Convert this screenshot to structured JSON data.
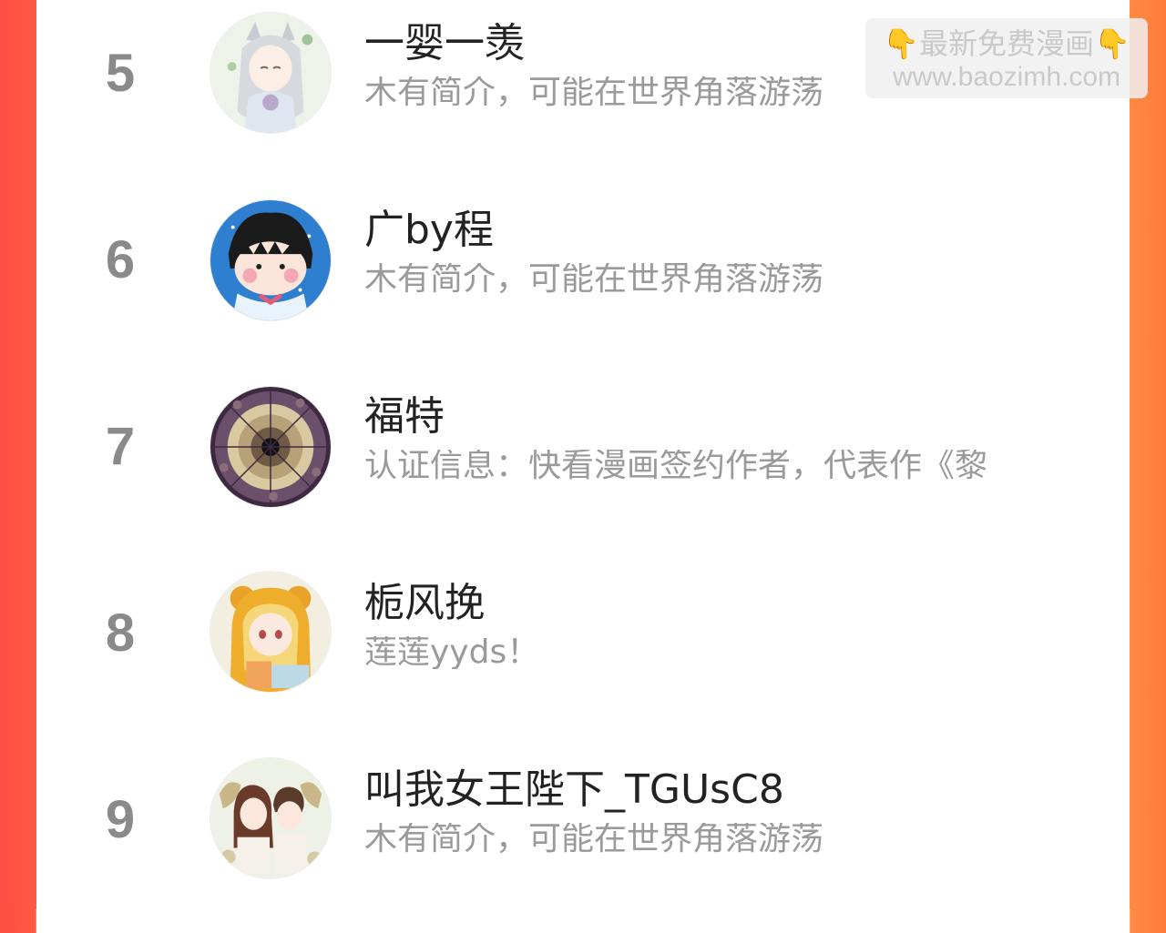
{
  "watermark": {
    "line1": "最新免费漫画",
    "line2": "www.baozimh.com",
    "hand_glyph": "👇"
  },
  "ranking": [
    {
      "rank": "5",
      "name": "一婴一羡",
      "desc": "木有简介，可能在世界角落游荡",
      "avatar": "anime-girl-gray-hair-avatar"
    },
    {
      "rank": "6",
      "name": "广by程",
      "desc": "木有简介，可能在世界角落游荡",
      "avatar": "cartoon-boy-blue-avatar"
    },
    {
      "rank": "7",
      "name": "福特",
      "desc": "认证信息：快看漫画签约作者，代表作《黎",
      "avatar": "vortex-mosaic-avatar"
    },
    {
      "rank": "8",
      "name": "栀风挽",
      "desc": "莲莲yyds！",
      "avatar": "bear-hood-girl-avatar"
    },
    {
      "rank": "9",
      "name": "叫我女王陛下_TGUsC8",
      "desc": "木有简介，可能在世界角落游荡",
      "avatar": "couple-illustration-avatar"
    }
  ],
  "colors": {
    "left_border": "#ff4d45",
    "right_border": "#ff8a45",
    "rank": "#8a8a8a",
    "name": "#222222",
    "desc": "#9a9a9a"
  }
}
